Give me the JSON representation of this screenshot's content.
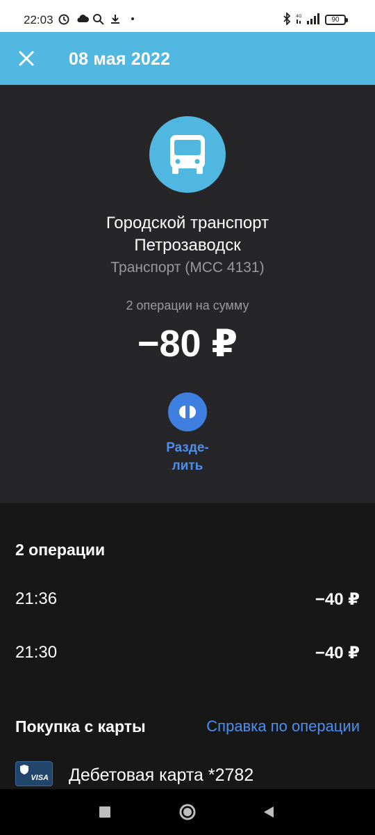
{
  "status_bar": {
    "time": "22:03",
    "battery": "90",
    "icons": [
      "alarm-icon",
      "cloud-icon",
      "search-icon",
      "download-icon",
      "dot-icon",
      "bluetooth-icon",
      "lte-signal-icon",
      "signal-icon",
      "battery-icon"
    ]
  },
  "app_bar": {
    "title": "08 мая 2022",
    "close_icon": "close-icon"
  },
  "header": {
    "category_icon": "bus-icon",
    "merchant_line1": "Городской транспорт",
    "merchant_line2": "Петрозаводск",
    "mcc": "Транспорт (MCC 4131)",
    "ops_summary": "2 операции на сумму",
    "total": "−80 ₽",
    "split_label_line1": "Разде-",
    "split_label_line2": "лить"
  },
  "operations": {
    "title": "2 операции",
    "items": [
      {
        "time": "21:36",
        "amount": "−40 ₽"
      },
      {
        "time": "21:30",
        "amount": "−40 ₽"
      }
    ]
  },
  "purchase": {
    "title": "Покупка с карты",
    "help_link": "Справка по операции",
    "card_brand": "VISA",
    "card_name": "Дебетовая карта *2782"
  },
  "colors": {
    "accent_blue": "#4fb7e0",
    "link_blue": "#4d8ff0",
    "button_blue": "#3e7fe0",
    "header_bg": "#262628",
    "body_bg": "#171718"
  }
}
